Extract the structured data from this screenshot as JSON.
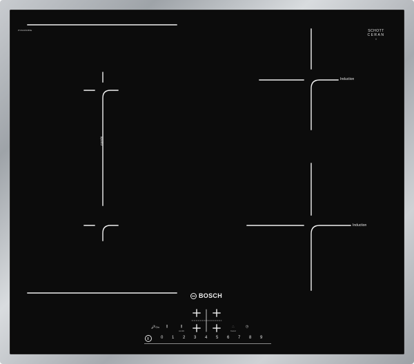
{
  "hob": {
    "model": "PVS645FB5E",
    "brand": "BOSCH",
    "ceran": {
      "line1": "SCHOTT",
      "line2": "CERAN",
      "line3": "®"
    }
  },
  "zones": {
    "combi_label": "combi",
    "induction_label_1": "Induction",
    "induction_label_2": "Induction"
  },
  "controls": {
    "childlock": "On",
    "childlock_caption": "",
    "panboost_caption": "",
    "combi_caption": "combi",
    "boost_caption": "boost",
    "timer_icon": "clock-icon",
    "power_icon": "power-icon"
  },
  "power_levels": [
    "0",
    "1",
    "2",
    "3",
    "4",
    "5",
    "6",
    "7",
    "8",
    "9"
  ],
  "colors": {
    "glass": "#0c0c0c",
    "marks": "#f2f2f2",
    "frame": "#b9bcc0"
  }
}
